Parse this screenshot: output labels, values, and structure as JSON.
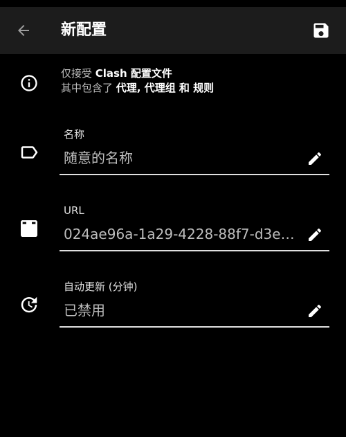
{
  "toolbar": {
    "title": "新配置",
    "back_icon": "arrow-back-icon",
    "save_icon": "save-icon"
  },
  "info": {
    "line1_prefix": "仅接受 ",
    "line1_bold": "Clash 配置文件",
    "line2_prefix": "其中包含了 ",
    "line2_bold": "代理, 代理组 和 规则",
    "icon": "info-icon"
  },
  "fields": {
    "name": {
      "label": "名称",
      "value": "随意的名称",
      "icon": "label-tag-icon"
    },
    "url": {
      "label": "URL",
      "value": "024ae96a-1a29-4228-88f7-d3eb…",
      "icon": "download-icon"
    },
    "update": {
      "label": "自动更新 (分钟)",
      "value": "已禁用",
      "icon": "update-clock-icon"
    }
  },
  "colors": {
    "background": "#000000",
    "toolbar": "#1c1c1c",
    "text_primary": "#ffffff",
    "text_secondary": "#bdbdbd",
    "underline": "#e0e0e0"
  }
}
